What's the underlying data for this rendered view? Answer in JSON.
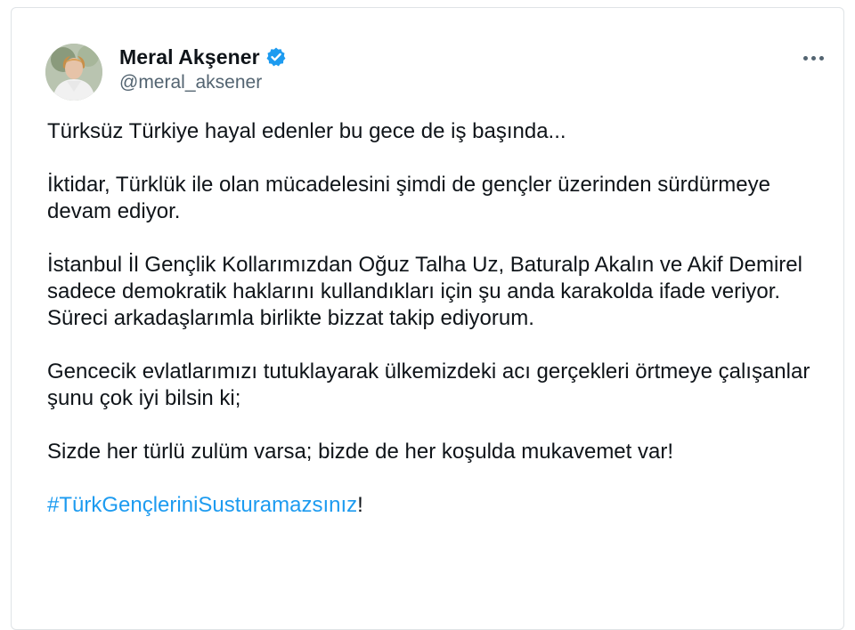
{
  "tweet": {
    "author": {
      "name": "Meral Akşener",
      "handle": "@meral_aksener",
      "verified_icon": "verified-badge-icon",
      "more_icon": "more-options-icon"
    },
    "paragraphs": [
      "Türksüz Türkiye hayal edenler bu gece de iş başında...",
      "İktidar, Türklük ile olan mücadelesini şimdi de gençler üzerinden sürdürmeye devam ediyor.",
      "İstanbul İl Gençlik Kollarımızdan Oğuz Talha Uz, Baturalp Akalın ve Akif Demirel sadece demokratik haklarını kullandıkları için şu anda karakolda ifade veriyor. Süreci arkadaşlarımla birlikte bizzat takip ediyorum.",
      "Gencecik evlatlarımızı tutuklayarak ülkemizdeki acı gerçekleri örtmeye çalışanlar şunu çok iyi bilsin ki;",
      "Sizde her türlü zulüm varsa; bizde de her koşulda mukavemet var!"
    ],
    "hashtag": "#TürkGençleriniSusturamazsınız",
    "hashtag_suffix": "!"
  },
  "colors": {
    "text": "#0f1419",
    "secondary": "#536471",
    "accent": "#1d9bf0"
  }
}
